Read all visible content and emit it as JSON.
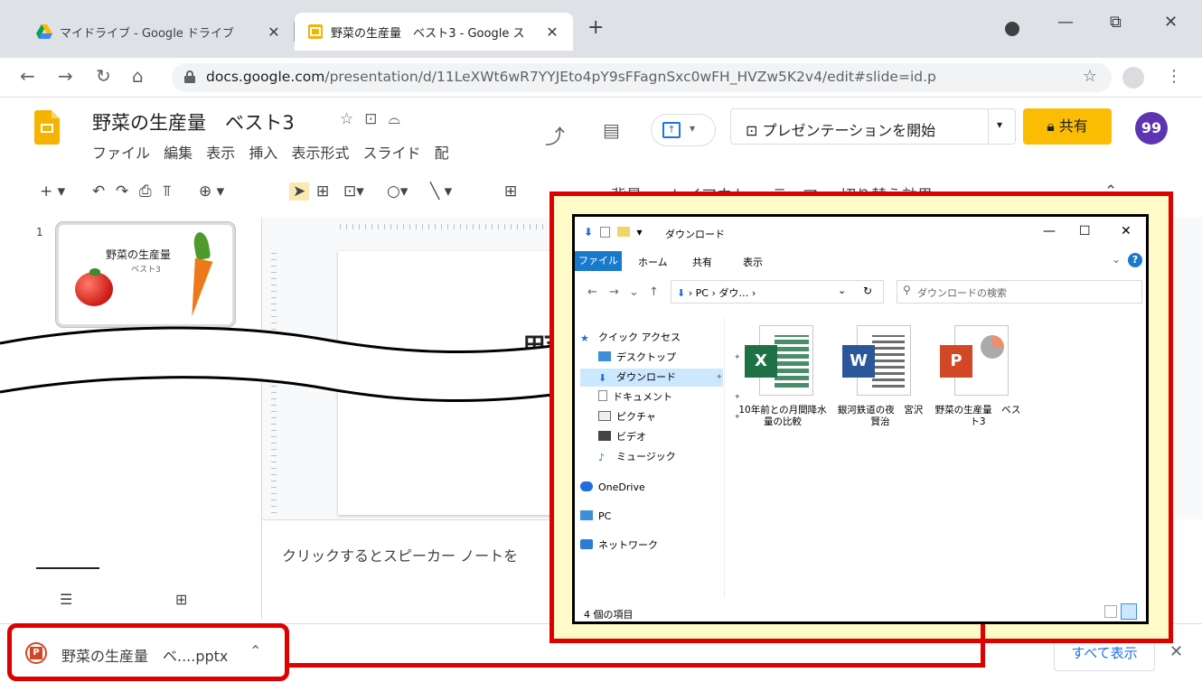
{
  "browser": {
    "tabs": [
      {
        "title": "マイドライブ - Google ドライブ",
        "close": "✕"
      },
      {
        "title": "野菜の生産量　ベスト3 - Google ス",
        "close": "✕"
      }
    ],
    "new_tab": "+",
    "window_controls": {
      "minimize": "—",
      "restore": "⧉",
      "close": "✕"
    },
    "url_host": "docs.google.com",
    "url_path": "/presentation/d/11LeXWt6wR7YYJEto4pY9sFFagnSxc0wFH_HVZw5K2v4/edit#slide=id.p"
  },
  "slides": {
    "doc_title": "野菜の生産量　ベスト3",
    "menu": [
      "ファイル",
      "編集",
      "表示",
      "挿入",
      "表示形式",
      "スライド",
      "配"
    ],
    "present_label": "プレゼンテーションを開始",
    "share_label": "共有",
    "avatar_label": "99",
    "toolbar_items": [
      "背景",
      "レイアウト▾",
      "テーマ",
      "切り替え効果"
    ],
    "slide_number": "1",
    "thumb_title": "野菜の生産量",
    "thumb_subtitle": "ベスト3",
    "slide_big_text": "野",
    "notes_placeholder": "クリックするとスピーカー ノートを"
  },
  "explorer": {
    "title": "ダウンロード",
    "ribbon": {
      "file": "ファイル",
      "tabs": [
        "ホーム",
        "共有",
        "表示"
      ]
    },
    "path": [
      "PC",
      "ダウ…"
    ],
    "search_placeholder": "ダウンロードの検索",
    "nav": [
      {
        "label": "クイック アクセス"
      },
      {
        "label": "デスクトップ"
      },
      {
        "label": "ダウンロード"
      },
      {
        "label": "ドキュメント"
      },
      {
        "label": "ピクチャ"
      },
      {
        "label": "ビデオ"
      },
      {
        "label": "ミュージック"
      },
      {
        "label": "OneDrive"
      },
      {
        "label": "PC"
      },
      {
        "label": "ネットワーク"
      }
    ],
    "files": [
      {
        "name": "10年前との月間降水量の比較",
        "type": "excel",
        "badge": "X"
      },
      {
        "name": "銀河鉄道の夜　宮沢　賢治",
        "type": "word",
        "badge": "W"
      },
      {
        "name": "野菜の生産量　ベスト3",
        "type": "powerpoint",
        "badge": "P"
      }
    ],
    "status": "4 個の項目"
  },
  "download": {
    "file": "野菜の生産量　ベ....pptx",
    "show_all": "すべて表示",
    "close": "✕"
  },
  "colors": {
    "annotation_red": "#e00000",
    "callout_bg": "#fefbc9",
    "share_yellow": "#fbbc04",
    "slides_logo": "#f4b400",
    "avatar_purple": "#5e35b1"
  }
}
